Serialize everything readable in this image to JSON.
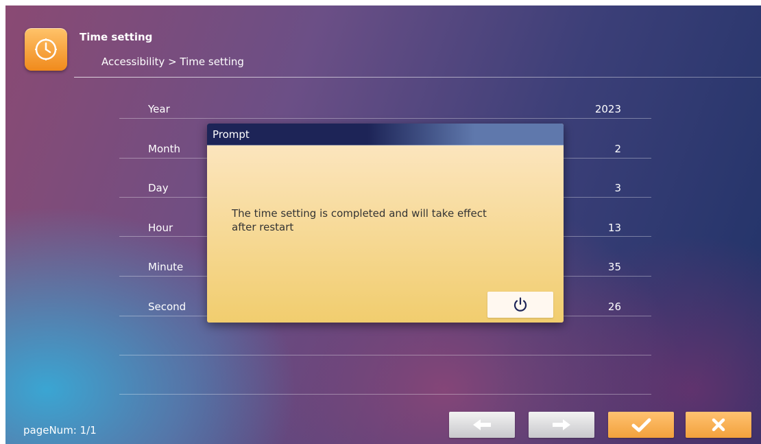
{
  "header": {
    "title": "Time setting",
    "breadcrumb": "Accessibility > Time setting",
    "icon": "clock-icon"
  },
  "rows": [
    {
      "label": "Year",
      "value": "2023"
    },
    {
      "label": "Month",
      "value": "2"
    },
    {
      "label": "Day",
      "value": "3"
    },
    {
      "label": "Hour",
      "value": "13"
    },
    {
      "label": "Minute",
      "value": "35"
    },
    {
      "label": "Second",
      "value": "26"
    }
  ],
  "footer": {
    "page_num": "pageNum: 1/1",
    "buttons": [
      {
        "icon": "arrow-left-icon"
      },
      {
        "icon": "arrow-right-icon"
      },
      {
        "icon": "check-icon"
      },
      {
        "icon": "close-icon"
      }
    ]
  },
  "dialog": {
    "title": "Prompt",
    "message": "The time setting is completed and will take effect after restart",
    "button_icon": "power-icon"
  },
  "colors": {
    "accent_orange": "#f2a13c",
    "dialog_header": "#1d2457",
    "dialog_body": "#f1cd6e"
  }
}
